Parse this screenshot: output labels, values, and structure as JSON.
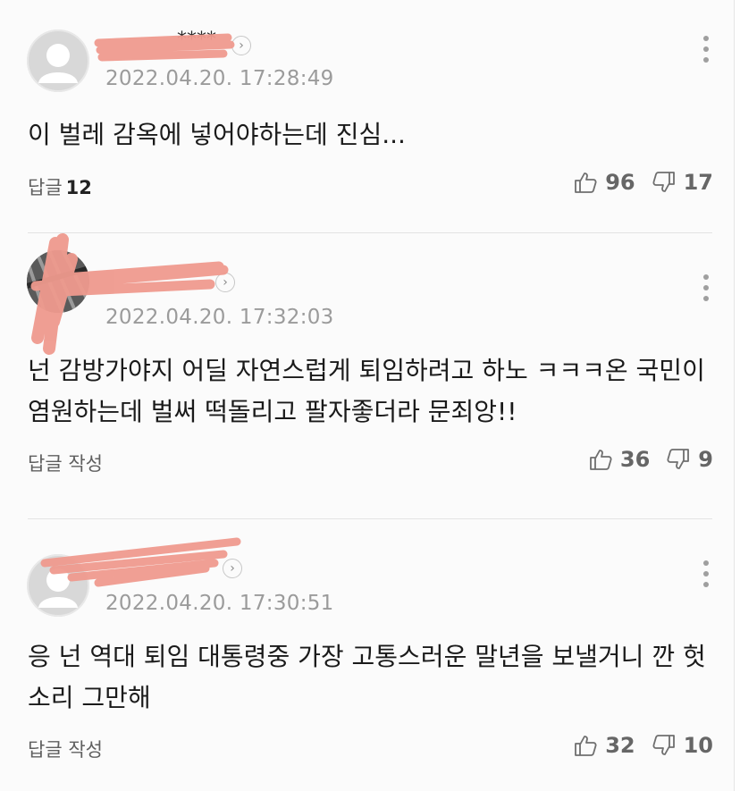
{
  "comments": [
    {
      "username": "****",
      "timestamp": "2022.04.20. 17:28:49",
      "text": "이 벌레 감옥에 넣어야하는데 진심...",
      "reply_label": "답글",
      "reply_count": "12",
      "likes": "96",
      "dislikes": "17"
    },
    {
      "username": "",
      "timestamp": "2022.04.20. 17:32:03",
      "text": "넌 감방가야지 어딜 자연스럽게 퇴임하려고 하노 ㅋㅋㅋ온 국민이 염원하는데 벌써 떡돌리고 팔자좋더라 문죄앙!!",
      "reply_label": "답글 작성",
      "reply_count": "",
      "likes": "36",
      "dislikes": "9"
    },
    {
      "username": "",
      "timestamp": "2022.04.20. 17:30:51",
      "text": "응 넌 역대 퇴임 대통령중 가장 고통스러운 말년을 보낼거니 깐 헛소리 그만해",
      "reply_label": "답글 작성",
      "reply_count": "",
      "likes": "32",
      "dislikes": "10"
    }
  ],
  "icons": {
    "avatar": "default-avatar-icon",
    "profile_arrow": "chevron-right-icon",
    "more": "more-vertical-icon",
    "like": "thumbs-up-icon",
    "dislike": "thumbs-down-icon"
  },
  "colors": {
    "redaction": "#ef9a8e",
    "background": "#fbfbfb",
    "timestamp": "#9b9b9b"
  }
}
